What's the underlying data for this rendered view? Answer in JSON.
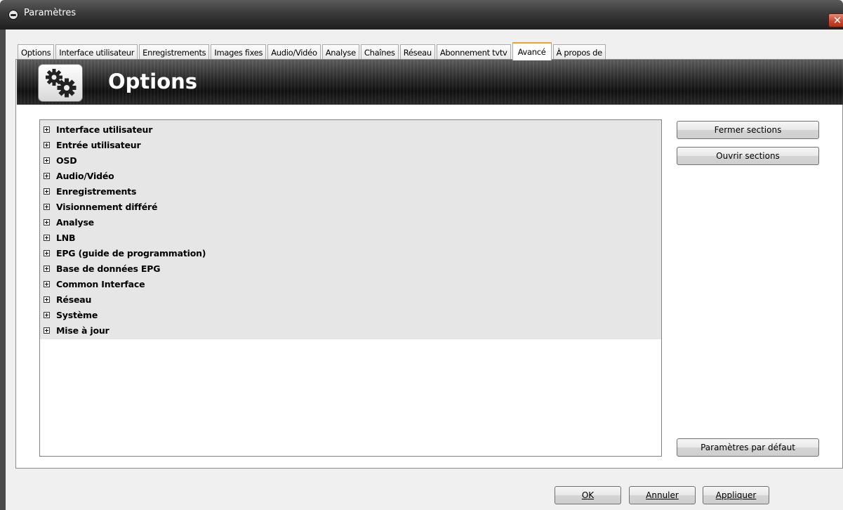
{
  "window": {
    "title": "Paramètres",
    "close_glyph": "✕"
  },
  "tabs": [
    {
      "label": "Options"
    },
    {
      "label": "Interface utilisateur"
    },
    {
      "label": "Enregistrements"
    },
    {
      "label": "Images fixes"
    },
    {
      "label": "Audio/Vidéo"
    },
    {
      "label": "Analyse"
    },
    {
      "label": "Chaînes"
    },
    {
      "label": "Réseau"
    },
    {
      "label": "Abonnement tvtv"
    },
    {
      "label": "Avancé",
      "active": true
    },
    {
      "label": "À propos de"
    }
  ],
  "banner": {
    "title": "Options",
    "icon": "gears-icon"
  },
  "tree": {
    "items": [
      "Interface utilisateur",
      "Entrée utilisateur",
      "OSD",
      "Audio/Vidéo",
      "Enregistrements",
      "Visionnement différé",
      "Analyse",
      "LNB",
      "EPG (guide de programmation)",
      "Base de données EPG",
      "Common Interface",
      "Réseau",
      "Système",
      "Mise à jour"
    ]
  },
  "side_buttons": {
    "collapse": "Fermer sections",
    "expand": "Ouvrir sections",
    "defaults": "Paramètres par défaut"
  },
  "footer": {
    "ok": "OK",
    "cancel": "Annuler",
    "apply": "Appliquer"
  },
  "colors": {
    "active_tab_accent": "#f0a030",
    "tree_background": "#e6e6e6"
  }
}
